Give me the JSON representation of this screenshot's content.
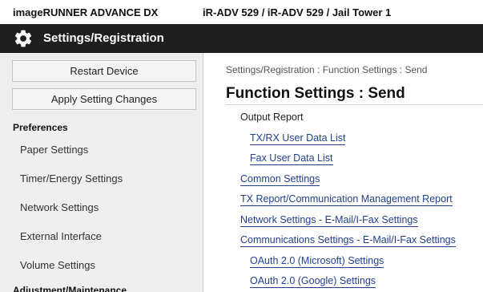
{
  "header": {
    "product_name": "imageRUNNER ADVANCE DX",
    "device_name": "iR-ADV 529 / iR-ADV 529 / Jail Tower 1"
  },
  "titlebar": {
    "title": "Settings/Registration",
    "icon": "gear-icon"
  },
  "sidebar": {
    "restart_label": "Restart Device",
    "apply_label": "Apply Setting Changes",
    "sections": [
      {
        "heading": "Preferences",
        "items": [
          {
            "label": "Paper Settings"
          },
          {
            "label": "Timer/Energy Settings"
          },
          {
            "label": "Network Settings"
          },
          {
            "label": "External Interface"
          },
          {
            "label": "Volume Settings"
          }
        ]
      },
      {
        "heading": "Adjustment/Maintenance"
      }
    ]
  },
  "main": {
    "breadcrumb": "Settings/Registration : Function Settings : Send",
    "title": "Function Settings : Send",
    "entries": [
      {
        "label": "Output Report",
        "type": "text"
      },
      {
        "label": "TX/RX User Data List",
        "type": "link"
      },
      {
        "label": "Fax User Data List",
        "type": "link"
      },
      {
        "label": "Common Settings",
        "type": "link"
      },
      {
        "label": "TX Report/Communication Management Report",
        "type": "link"
      },
      {
        "label": "Network Settings - E-Mail/I-Fax Settings",
        "type": "link"
      },
      {
        "label": "Communications Settings - E-Mail/I-Fax Settings",
        "type": "link"
      },
      {
        "label": "OAuth 2.0 (Microsoft) Settings",
        "type": "link"
      },
      {
        "label": "OAuth 2.0 (Google) Settings",
        "type": "link"
      }
    ]
  },
  "colors": {
    "titlebar_bg": "#1f1f1f",
    "sidebar_bg": "#efefef",
    "link": "#23408e"
  }
}
